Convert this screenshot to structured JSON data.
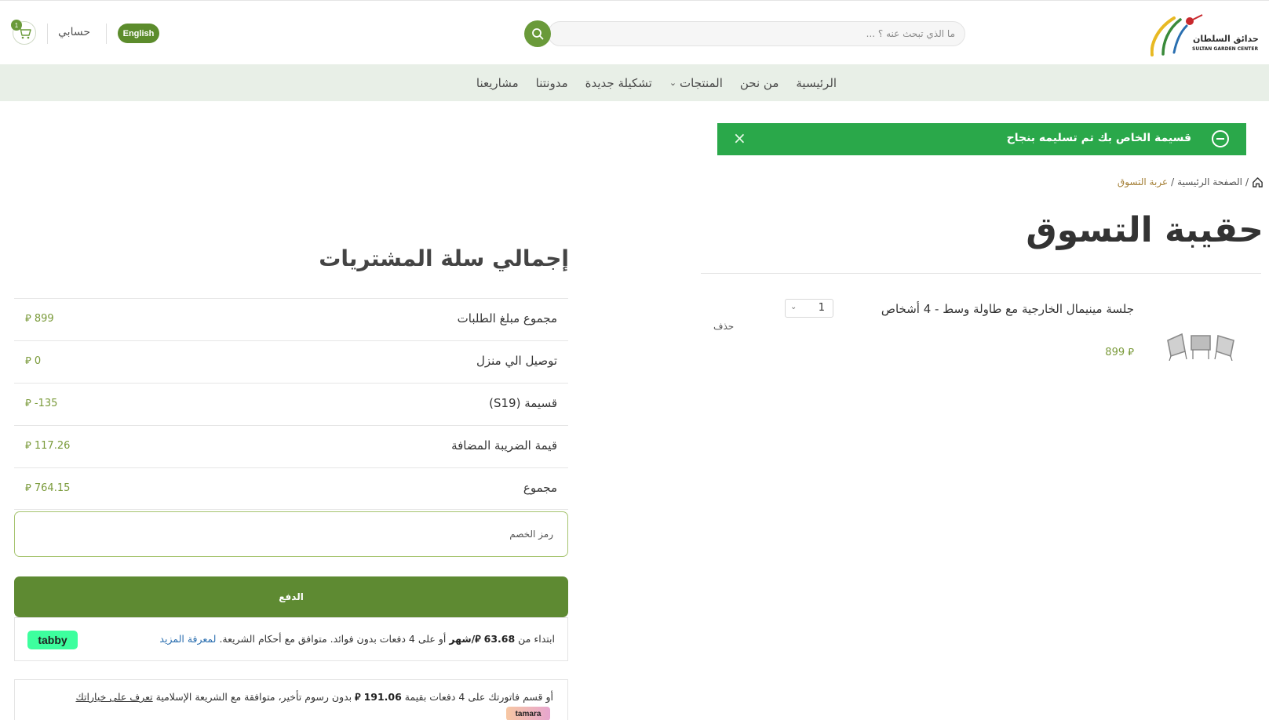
{
  "header": {
    "logo_ar": "حدائق السلطان",
    "logo_en": "SULTAN GARDEN CENTER",
    "search_placeholder": "ما الذي تبحث عنه ؟ ...",
    "language_button": "English",
    "account_label": "حسابي",
    "cart_count": "1"
  },
  "nav": {
    "items": [
      {
        "label": "الرئيسية"
      },
      {
        "label": "من نحن"
      },
      {
        "label": "المنتجات"
      },
      {
        "label": "تشكيلة جديدة"
      },
      {
        "label": "مدونتنا"
      },
      {
        "label": "مشاريعنا"
      }
    ]
  },
  "alert": {
    "message": "قسيمة الخاص بك تم تسليمه بنجاح",
    "color": "#2aa84a"
  },
  "breadcrumb": {
    "home": "الصفحة الرئيسية",
    "separator": "/",
    "current": "عربة التسوق"
  },
  "page_title": "حقيبة التسوق",
  "cart": {
    "items": [
      {
        "name": "جلسة مينيمال الخارجية مع طاولة وسط - 4 أشخاص",
        "price": "899",
        "quantity": "1",
        "remove_label": "حذف"
      }
    ]
  },
  "totals": {
    "title": "إجمالي سلة المشتريات",
    "rows": [
      {
        "label": "مجموع مبلغ الطلبات",
        "value": "899"
      },
      {
        "label": "توصيل الي منزل",
        "value": "0"
      },
      {
        "label": "قسيمة (S19)",
        "value": "-135"
      },
      {
        "label": "قيمة الضريبة المضافة",
        "value": "117.26"
      },
      {
        "label": "مجموع",
        "value": "764.15"
      }
    ],
    "coupon_placeholder": "رمز الخصم",
    "pay_button": "الدفع"
  },
  "tabby": {
    "text_start": "ابتداء من",
    "amount": "63.68",
    "per_month": "/شهر",
    "text_rest": "أو على 4 دفعات بدون فوائد. متوافق مع أحكام الشريعة.",
    "learn_more": "لمعرفة المزيد",
    "brand": "tabby"
  },
  "tamara": {
    "text_start": "أو قسم فاتورتك على 4 دفعات بقيمة",
    "amount": "191.06",
    "text_rest": "بدون رسوم تأخير، متوافقة مع الشريعة الإسلامية",
    "link": "تعرف على خياراتك",
    "brand": "tamara"
  },
  "colors": {
    "brand_green": "#5e8a32",
    "nav_bg": "#e8efe7",
    "price_green": "#7a9a3a",
    "breadcrumb_current": "#a47f36"
  }
}
